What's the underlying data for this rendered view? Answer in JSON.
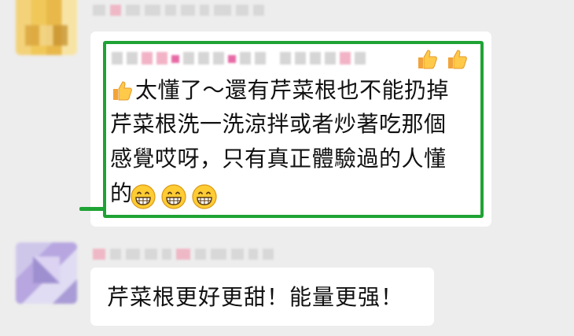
{
  "chat": {
    "message1": {
      "line1": "太懂了～還有芹菜根也不能扔掉",
      "line2": "芹菜根洗一洗涼拌或者炒著吃那個",
      "line3": "感覺哎呀，只有真正體驗過的人懂",
      "line4": "的",
      "emoji_thumb": "thumbs-up-icon",
      "emoji_grin": "grinning-face-icon"
    },
    "message2": {
      "text": "芹菜根更好更甜！能量更强！"
    }
  },
  "colors": {
    "background": "#ededed",
    "bubble": "#ffffff",
    "highlight": "#1ea334"
  }
}
